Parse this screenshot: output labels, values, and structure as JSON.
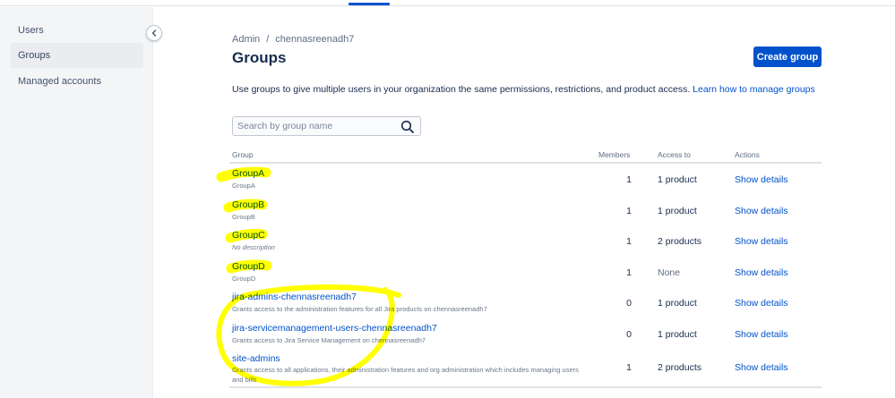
{
  "sidebar": {
    "items": [
      {
        "label": "Users"
      },
      {
        "label": "Groups"
      },
      {
        "label": "Managed accounts"
      }
    ]
  },
  "breadcrumb": {
    "root": "Admin",
    "separator": "/",
    "org": "chennasreenadh7"
  },
  "header": {
    "title": "Groups",
    "create_label": "Create group"
  },
  "description": {
    "text": "Use groups to give multiple users in your organization the same permissions, restrictions, and product access.",
    "link": "Learn how to manage groups"
  },
  "search": {
    "placeholder": "Search by group name"
  },
  "table": {
    "headers": {
      "group": "Group",
      "members": "Members",
      "access": "Access to",
      "actions": "Actions"
    },
    "rows": [
      {
        "name": "GroupA",
        "description": "GroupA",
        "members": "1",
        "access": "1 product",
        "action": "Show details"
      },
      {
        "name": "GroupB",
        "description": "GroupB",
        "members": "1",
        "access": "1 product",
        "action": "Show details"
      },
      {
        "name": "GroupC",
        "description": "No description",
        "members": "1",
        "access": "2 products",
        "action": "Show details"
      },
      {
        "name": "GroupD",
        "description": "GroupD",
        "members": "1",
        "access": "None",
        "action": "Show details"
      },
      {
        "name": "jira-admins-chennasreenadh7",
        "description": "Grants access to the administration features for all Jira products on chennasreenadh7",
        "members": "0",
        "access": "1 product",
        "action": "Show details"
      },
      {
        "name": "jira-servicemanagement-users-chennasreenadh7",
        "description": "Grants access to Jira Service Management on chennasreenadh7",
        "members": "0",
        "access": "1 product",
        "action": "Show details"
      },
      {
        "name": "site-admins",
        "description": "Grants access to all applications, their administration features and org administration which includes managing users and bills",
        "members": "1",
        "access": "2 products",
        "action": "Show details"
      }
    ]
  },
  "colors": {
    "brand": "#0052cc",
    "highlight": "#ffff00",
    "sidebar_bg": "#f4f5f7"
  }
}
